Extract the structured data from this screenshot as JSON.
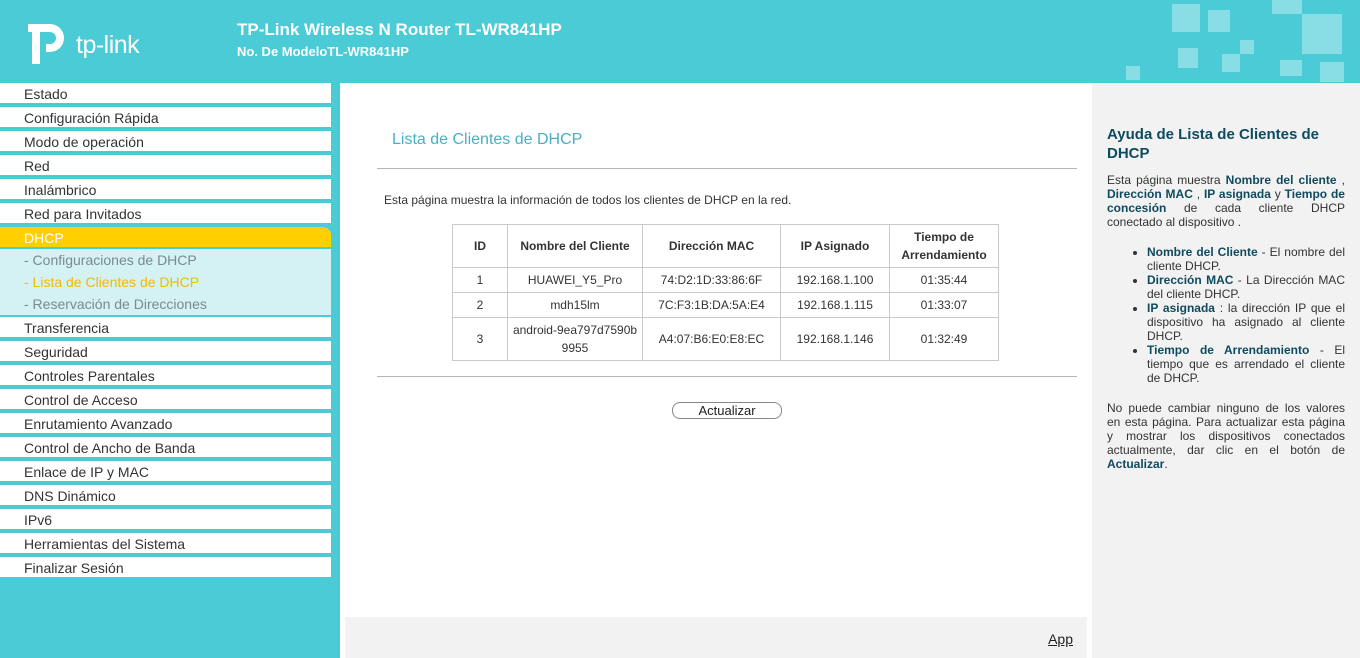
{
  "header": {
    "logo_text": "tp-link",
    "title": "TP-Link Wireless N Router TL-WR841HP",
    "model": "No. De ModeloTL-WR841HP"
  },
  "sidebar": {
    "items": [
      {
        "label": "Estado"
      },
      {
        "label": "Configuración Rápida"
      },
      {
        "label": "Modo de operación"
      },
      {
        "label": "Red"
      },
      {
        "label": "Inalámbrico"
      },
      {
        "label": "Red para Invitados"
      },
      {
        "label": "DHCP"
      },
      {
        "label": "Transferencia"
      },
      {
        "label": "Seguridad"
      },
      {
        "label": "Controles Parentales"
      },
      {
        "label": "Control de Acceso"
      },
      {
        "label": "Enrutamiento Avanzado"
      },
      {
        "label": "Control de Ancho de Banda"
      },
      {
        "label": "Enlace de IP y MAC"
      },
      {
        "label": "DNS Dinámico"
      },
      {
        "label": "IPv6"
      },
      {
        "label": "Herramientas del Sistema"
      },
      {
        "label": "Finalizar Sesión"
      }
    ],
    "submenu": [
      {
        "label": "- Configuraciones de DHCP"
      },
      {
        "label": "- Lista de Clientes de DHCP"
      },
      {
        "label": "- Reservación de Direcciones"
      }
    ]
  },
  "main": {
    "title": "Lista de Clientes de DHCP",
    "description": "Esta página muestra la información de todos los clientes de DHCP en la red.",
    "table": {
      "headers": [
        "ID",
        "Nombre del Cliente",
        "Dirección MAC",
        "IP Asignado",
        "Tiempo de Arrendamiento"
      ],
      "rows": [
        [
          "1",
          "HUAWEI_Y5_Pro",
          "74:D2:1D:33:86:6F",
          "192.168.1.100",
          "01:35:44"
        ],
        [
          "2",
          "mdh15lm",
          "7C:F3:1B:DA:5A:E4",
          "192.168.1.115",
          "01:33:07"
        ],
        [
          "3",
          "android-9ea797d7590b9955",
          "A4:07:B6:E0:E8:EC",
          "192.168.1.146",
          "01:32:49"
        ]
      ]
    },
    "refresh_label": "Actualizar",
    "app_link": "App"
  },
  "help": {
    "title": "Ayuda de Lista de Clientes de DHCP",
    "intro": {
      "t1": "Esta página muestra ",
      "b1": "Nombre del cliente",
      "t2": " , ",
      "b2": "Dirección MAC",
      "t3": " , ",
      "b3": "IP asignada",
      "t4": " y ",
      "b4": "Tiempo de concesión",
      "t5": " de cada cliente DHCP conectado al dispositivo ."
    },
    "bullets": [
      {
        "term": "Nombre del Cliente",
        "text": " - El nombre del cliente DHCP."
      },
      {
        "term": "Dirección MAC",
        "text": " - La Dirección MAC del cliente DHCP."
      },
      {
        "term": "IP asignada",
        "text": " : la dirección IP que el dispositivo ha asignado al cliente DHCP."
      },
      {
        "term": "Tiempo de Arrendamiento",
        "text": " - El tiempo que es arrendado el cliente de DHCP."
      }
    ],
    "note": {
      "text": "No puede cambiar ninguno de los valores en esta página. Para actualizar esta página y mostrar los dispositivos conectados actualmente, dar clic en el botón de ",
      "term": "Actualizar",
      "end": "."
    }
  },
  "colors": {
    "brand": "#4acbd6",
    "active_menu": "#ffcf00",
    "submenu_bg": "#d4f1f4",
    "title_color": "#4aafc4",
    "help_title": "#0e4b5f"
  }
}
